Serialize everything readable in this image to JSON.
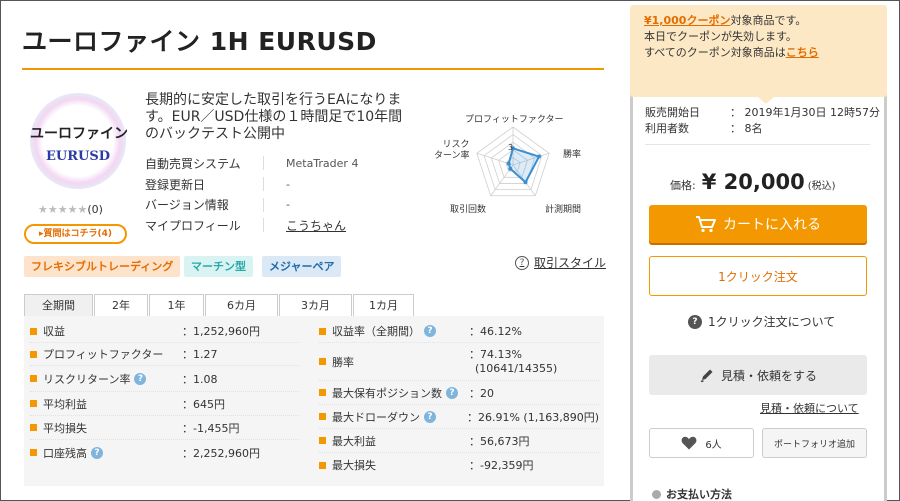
{
  "product": {
    "title": "ユーロファイン 1H EURUSD",
    "logo_line1": "ユーロファイン",
    "logo_line2": "EURUSD",
    "rating_stars": "★★★★★",
    "rating_count": "(0)",
    "question_button": "▸質問はコチラ(4)",
    "description": "長期的に安定した取引を行うEAになります。EUR／USD仕様の１時間足で10年間のバックテスト公開中"
  },
  "spec": [
    {
      "key": "自動売買システム",
      "value": "MetaTrader 4"
    },
    {
      "key": "登録更新日",
      "value": "-"
    },
    {
      "key": "バージョン情報",
      "value": "-"
    },
    {
      "key": "マイプロフィール",
      "value": "こうちゃん"
    }
  ],
  "radar": {
    "labels": [
      "プロフィットファクター",
      "勝率",
      "計測期間",
      "取引回数",
      "リスク\nターン率"
    ],
    "scale_label": "3",
    "values": [
      2.2,
      3.6,
      2.8,
      0.6,
      0.6
    ],
    "max": 5,
    "colors": {
      "grid": "#cfcfcf",
      "line": "#3a8fd1",
      "fill": "rgba(58,143,209,0.18)"
    }
  },
  "tags": [
    "フレキシブルトレーディング",
    "マーチン型",
    "メジャーペア"
  ],
  "style_link": "取引スタイル",
  "tabs": [
    "全期間",
    "2年",
    "1年",
    "6カ月",
    "3カ月",
    "1カ月"
  ],
  "stats_left": [
    {
      "label": "収益",
      "value": "：1,252,960円",
      "hint": false
    },
    {
      "label": "プロフィットファクター",
      "value": "：1.27",
      "hint": false
    },
    {
      "label": "リスクリターン率",
      "value": "：1.08",
      "hint": true
    },
    {
      "label": "平均利益",
      "value": "：645円",
      "hint": false
    },
    {
      "label": "平均損失",
      "value": "：-1,455円",
      "hint": false
    },
    {
      "label": "口座残高",
      "value": "：2,252,960円",
      "hint": true
    }
  ],
  "stats_right": [
    {
      "label": "収益率（全期間）",
      "value": "：46.12%",
      "hint": true
    },
    {
      "label": "勝率",
      "value": "：74.13%",
      "value2": "(10641/14355)",
      "hint": false
    },
    {
      "label": "最大保有ポジション数",
      "value": "：20",
      "hint": true
    },
    {
      "label": "最大ドローダウン",
      "value": "：26.91% (1,163,890円)",
      "hint": true
    },
    {
      "label": "最大利益",
      "value": "：56,673円",
      "hint": false
    },
    {
      "label": "最大損失",
      "value": "：-92,359円",
      "hint": false
    }
  ],
  "coupon": {
    "line1_link": "¥1,000クーポン",
    "line1_rest": "対象商品です。",
    "line2": "本日でクーポンが失効します。",
    "line3_rest": "すべてのクーポン対象商品は",
    "line3_link": "こちら"
  },
  "sales": {
    "start_label": "販売開始日",
    "start_value": "：  2019年1月30日  12時57分",
    "users_label": "利用者数",
    "users_value": "：  8名"
  },
  "price": {
    "label": "価格:",
    "value": "¥ 20,000",
    "tax": "(税込)"
  },
  "buttons": {
    "cart": "カートに入れる",
    "one_click": "1クリック注文",
    "one_click_about": "1クリック注文について",
    "estimate": "見積・依頼をする",
    "estimate_about": "見積・依頼について",
    "like_count": "6人",
    "portfolio": "ポートフォリオ追加"
  },
  "payment": "お支払い方法",
  "colors": {
    "accent": "#f39800",
    "accent_text": "#e46d00"
  }
}
